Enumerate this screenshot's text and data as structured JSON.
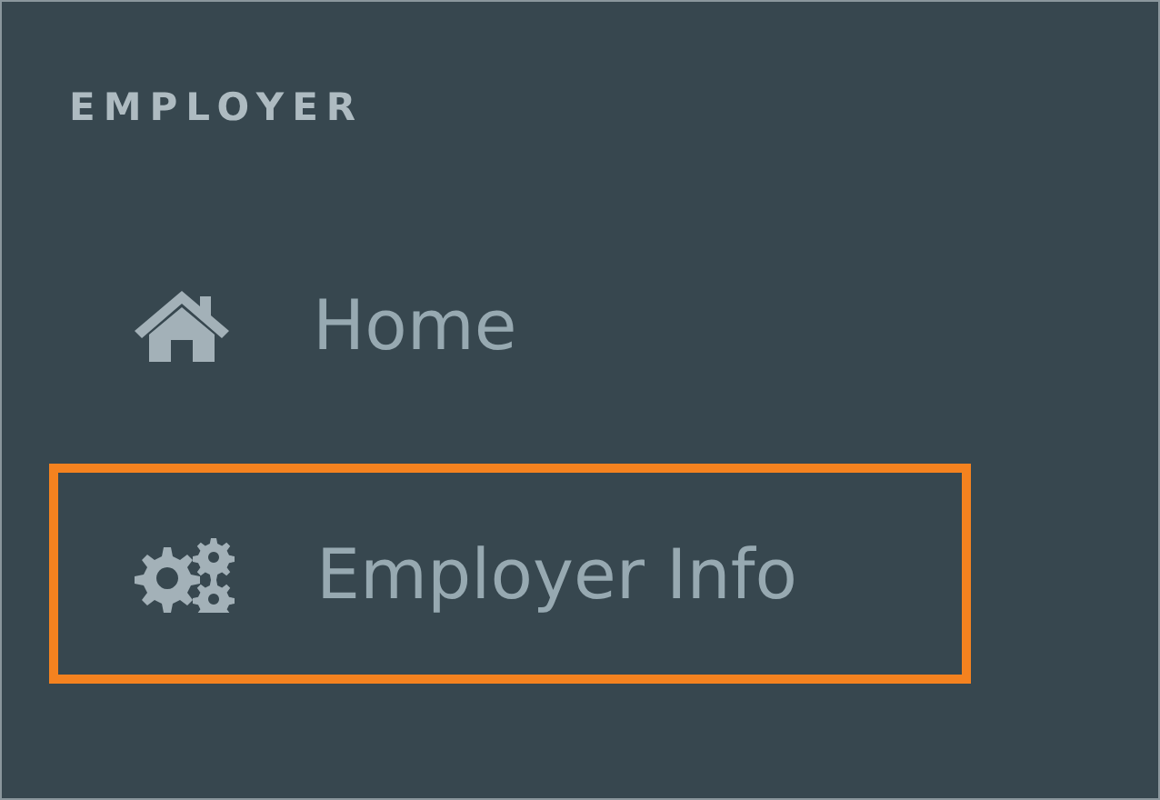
{
  "sidebar": {
    "section_title": "EMPLOYER",
    "items": [
      {
        "label": "Home",
        "kind": "home",
        "highlighted": false
      },
      {
        "label": "Employer Info",
        "kind": "settings",
        "highlighted": true
      }
    ]
  }
}
